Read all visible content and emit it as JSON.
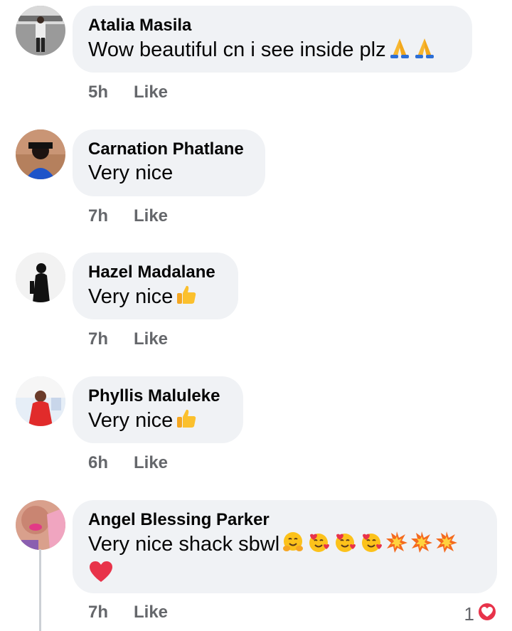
{
  "comments": [
    {
      "name": "Atalia Masila",
      "text": "Wow beautiful cn i see inside plz",
      "emojis": [
        "folded-hands",
        "folded-hands"
      ],
      "time": "5h",
      "like_label": "Like"
    },
    {
      "name": "Carnation Phatlane",
      "text": "Very nice",
      "emojis": [],
      "time": "7h",
      "like_label": "Like"
    },
    {
      "name": "Hazel Madalane",
      "text": "Very nice",
      "emojis": [
        "thumbs-up"
      ],
      "time": "7h",
      "like_label": "Like"
    },
    {
      "name": "Phyllis Maluleke",
      "text": "Very nice",
      "emojis": [
        "thumbs-up"
      ],
      "time": "6h",
      "like_label": "Like"
    },
    {
      "name": "Angel Blessing Parker",
      "text": "Very nice shack sbwl",
      "emojis": [
        "hugging-face",
        "smiling-face-with-hearts",
        "smiling-face-with-hearts",
        "smiling-face-with-hearts",
        "collision",
        "collision",
        "collision",
        "red-heart"
      ],
      "time": "7h",
      "like_label": "Like",
      "reaction_count": "1",
      "reaction_icon": "heart-reaction-icon"
    }
  ],
  "colors": {
    "bubble": "#f0f2f5",
    "meta": "#65676b",
    "heart": "#e8334a"
  }
}
